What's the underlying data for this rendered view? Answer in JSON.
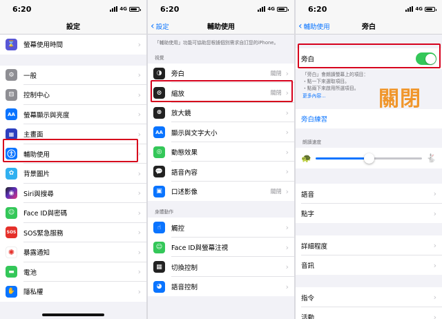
{
  "status": {
    "time": "6:20",
    "network": "4G"
  },
  "panel1": {
    "title": "設定",
    "top_item": {
      "label": "螢幕使用時間",
      "icon": "hourglass-icon",
      "color": "#5856d6"
    },
    "items": [
      {
        "label": "一般",
        "icon": "gear-icon",
        "color": "#8e8e93"
      },
      {
        "label": "控制中心",
        "icon": "toggles-icon",
        "color": "#8e8e93"
      },
      {
        "label": "螢幕顯示與亮度",
        "icon": "text-size-icon",
        "color": "#0a74ff"
      },
      {
        "label": "主畫面",
        "icon": "home-grid-icon",
        "color": "#2c3fbf"
      },
      {
        "label": "輔助使用",
        "icon": "accessibility-icon",
        "color": "#0a74ff"
      },
      {
        "label": "背景圖片",
        "icon": "flower-icon",
        "color": "#30b0f0"
      },
      {
        "label": "Siri與搜尋",
        "icon": "siri-icon",
        "color": "#222222"
      },
      {
        "label": "Face ID與密碼",
        "icon": "face-id-icon",
        "color": "#34c759"
      },
      {
        "label": "SOS緊急服務",
        "icon": "sos-icon",
        "color": "#e5302a"
      },
      {
        "label": "暴露通知",
        "icon": "exposure-icon",
        "color": "#ffffff"
      },
      {
        "label": "電池",
        "icon": "battery-icon",
        "color": "#34c759"
      },
      {
        "label": "隱私權",
        "icon": "hand-icon",
        "color": "#0a74ff"
      }
    ],
    "sos_text": "SOS",
    "aa_text": "AA"
  },
  "panel2": {
    "back": "設定",
    "title": "輔助使用",
    "description": "「輔助使用」功能可協助您根據個別需求自訂您的iPhone。",
    "section_vision": "視覺",
    "vision_items": [
      {
        "label": "旁白",
        "value": "關閉",
        "icon": "voiceover-icon",
        "color": "#222222"
      },
      {
        "label": "縮放",
        "value": "關閉",
        "icon": "zoom-icon",
        "color": "#222222"
      },
      {
        "label": "放大鏡",
        "value": "",
        "icon": "magnifier-icon",
        "color": "#222222"
      },
      {
        "label": "顯示與文字大小",
        "value": "",
        "icon": "text-size-icon",
        "color": "#0a74ff"
      },
      {
        "label": "動態效果",
        "value": "",
        "icon": "motion-icon",
        "color": "#34c759"
      },
      {
        "label": "語音內容",
        "value": "",
        "icon": "speech-icon",
        "color": "#222222"
      },
      {
        "label": "口述影像",
        "value": "關閉",
        "icon": "audio-desc-icon",
        "color": "#0a74ff"
      }
    ],
    "section_physical": "身體動作",
    "physical_items": [
      {
        "label": "觸控",
        "icon": "touch-icon",
        "color": "#0a74ff"
      },
      {
        "label": "Face ID與螢幕注視",
        "icon": "face-id-icon",
        "color": "#34c759"
      },
      {
        "label": "切換控制",
        "icon": "switch-control-icon",
        "color": "#222222"
      },
      {
        "label": "語音控制",
        "icon": "voice-control-icon",
        "color": "#0a74ff"
      }
    ],
    "aa_text": "AA"
  },
  "panel3": {
    "back": "輔助使用",
    "title": "旁白",
    "toggle_label": "旁白",
    "toggle_on": true,
    "hint_line1": "「旁白」會朗讀螢幕上的項目：",
    "hint_line2": "・點一下來選取項目。",
    "hint_line3": "・點兩下來啟用所選項目。",
    "more": "更多內容...",
    "big_label": "關閉",
    "practice": "旁白練習",
    "speed_section": "朗讀速度",
    "speed_fraction": 0.5,
    "group1": [
      "語音",
      "點字"
    ],
    "group2": [
      "詳細程度",
      "音訊"
    ],
    "group3": [
      "指令",
      "活動"
    ]
  },
  "colors": {
    "accent": "#0a74ff",
    "highlight": "#d6001c",
    "toggle_on": "#34c759",
    "annotation": "#f0962b"
  }
}
